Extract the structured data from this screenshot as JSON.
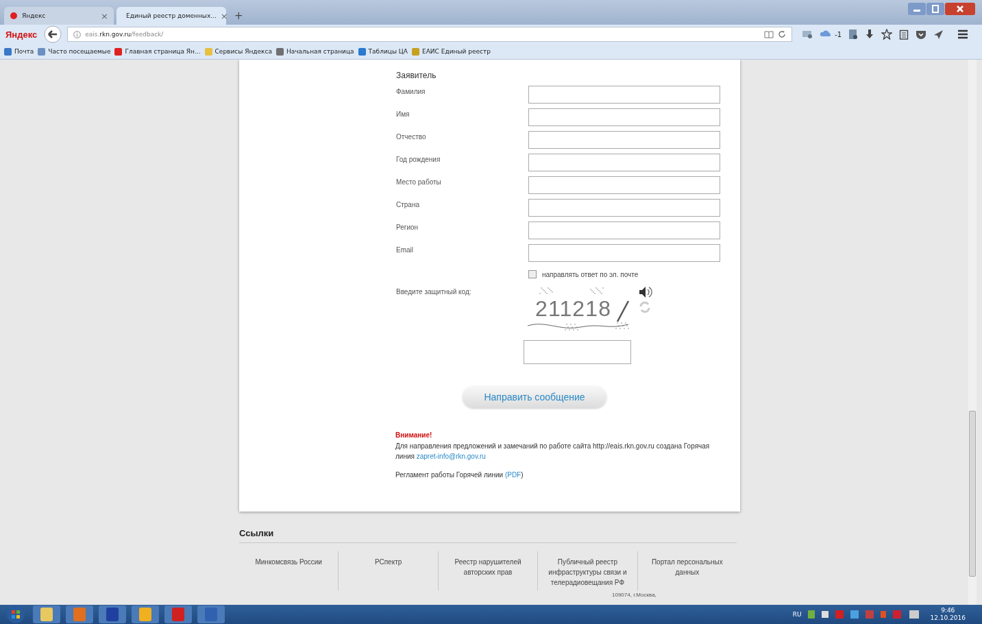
{
  "browser": {
    "tabs": [
      {
        "title": "Яндекс",
        "close": "×",
        "selected": false
      },
      {
        "title": "Единый реестр доменных...",
        "close": "×",
        "selected": true
      }
    ],
    "new_tab": "+",
    "brand": "Яндекс",
    "url": "eais.**rkn.gov.ru**/feedback/",
    "sync_count": "-1",
    "bookmarks": [
      "Почта",
      "Часто посещаемые",
      "Главная страница Ян...",
      "Сервисы Яндекса",
      "Начальная страница",
      "Таблицы ЦА",
      "ЕАИС Единый реестр"
    ]
  },
  "form": {
    "section": "Заявитель",
    "fields": [
      "Фамилия",
      "Имя",
      "Отчество",
      "Год рождения",
      "Место работы",
      "Страна",
      "Регион",
      "Email"
    ],
    "email_reply": {
      "label": "направлять ответ по эл. почте",
      "checked": false
    },
    "captcha_label": "Введите защитный код:",
    "captcha_code": "211218",
    "submit": "Направить сообщение",
    "notice": {
      "title": "Внимание!",
      "text": "Для направления предложений и замечаний по работе сайта http://eais.rkn.gov.ru создана Горячая линия",
      "email": "zapret-info@rkn.gov.ru"
    },
    "regulation": {
      "text": "Регламент работы Горячей линии",
      "open": "(",
      "link": "PDF",
      "close": ")"
    }
  },
  "footer": {
    "title": "Ссылки",
    "links": [
      "Минкомсвязь России",
      "РСпектр",
      "Реестр нарушителей авторских прав",
      "Публичный реестр инфраструктуры связи и телерадиовещания РФ",
      "Портал персональных данных"
    ],
    "address": "109074, г.Москва,"
  },
  "taskbar": {
    "lang": "RU",
    "time": "9:46",
    "date": "12.10.2016"
  }
}
